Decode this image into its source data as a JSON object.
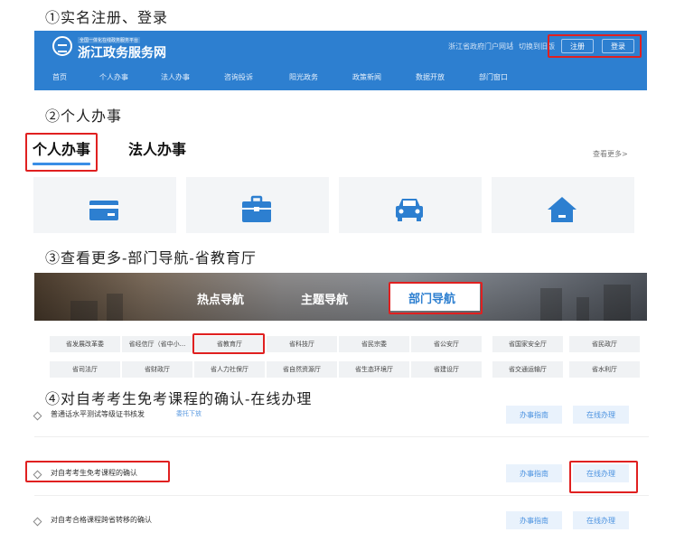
{
  "steps": {
    "s1": "①实名注册、登录",
    "s2": "②个人办事",
    "s3": "③查看更多-部门导航-省教育厅",
    "s4": "④对自考考生免考课程的确认-在线办理"
  },
  "header": {
    "logo_small": "全国一体化在线政务服务平台",
    "logo_title": "浙江政务服务网",
    "portal_link": "浙江省政府门户网站",
    "old_version_link": "切换到旧版",
    "register_label": "注册",
    "login_label": "登录",
    "nav": [
      "首页",
      "个人办事",
      "法人办事",
      "咨询投诉",
      "阳光政务",
      "政策新闻",
      "数据开放",
      "部门窗口"
    ]
  },
  "section2": {
    "tab_personal": "个人办事",
    "tab_legal": "法人办事",
    "see_more": "查看更多>",
    "cards": [
      "id-card-icon",
      "briefcase-icon",
      "car-icon",
      "house-icon"
    ]
  },
  "section3": {
    "tabs": [
      "热点导航",
      "主题导航",
      "部门导航"
    ],
    "departments_row1": [
      "省发展改革委",
      "省经信厅（省中小...",
      "省教育厅",
      "省科技厅",
      "省民宗委",
      "省公安厅",
      "省国家安全厅",
      "省民政厅"
    ],
    "departments_row2": [
      "省司法厅",
      "省财政厅",
      "省人力社保厅",
      "省自然资源厅",
      "省生态环境厅",
      "省建设厅",
      "省交通运输厅",
      "省水利厅"
    ]
  },
  "section4": {
    "services": [
      {
        "name": "普通话水平测试等级证书核发",
        "tag": "委托下放"
      },
      {
        "name": "对自考考生免考课程的确认",
        "tag": ""
      },
      {
        "name": "对自考合格课程跨省转移的确认",
        "tag": ""
      }
    ],
    "guide_label": "办事指南",
    "online_label": "在线办理"
  },
  "colors": {
    "brand_blue": "#2d7fd0",
    "highlight_red": "#e02020"
  }
}
